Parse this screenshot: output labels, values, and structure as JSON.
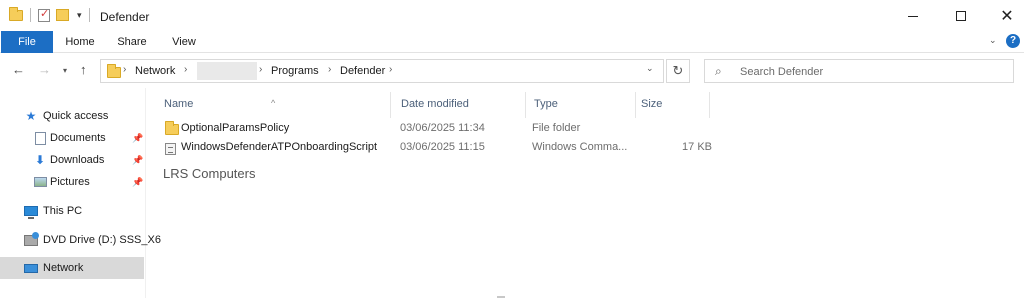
{
  "window": {
    "title": "Defender",
    "controls": {
      "minimize": "—",
      "maximize": "☐",
      "close": "✕"
    }
  },
  "ribbon": {
    "tabs": [
      "File",
      "Home",
      "Share",
      "View"
    ],
    "accent": "#1c6ec4",
    "help": "?"
  },
  "address": {
    "crumbs": [
      "Network",
      "",
      "Programs",
      "Defender"
    ],
    "separator": "›"
  },
  "search": {
    "placeholder": "Search Defender"
  },
  "sidebar": {
    "items": [
      {
        "label": "Quick access",
        "icon": "star-icon",
        "pinned": false
      },
      {
        "label": "Documents",
        "icon": "documents-icon",
        "pinned": true
      },
      {
        "label": "Downloads",
        "icon": "download-icon",
        "pinned": true
      },
      {
        "label": "Pictures",
        "icon": "pictures-icon",
        "pinned": true
      },
      {
        "label": "This PC",
        "icon": "computer-icon",
        "pinned": false
      },
      {
        "label": "DVD Drive (D:) SSS_X6",
        "icon": "dvd-drive-icon",
        "pinned": false
      },
      {
        "label": "Network",
        "icon": "network-icon",
        "pinned": false,
        "selected": true
      }
    ]
  },
  "columns": {
    "name": "Name",
    "date": "Date modified",
    "type": "Type",
    "size": "Size"
  },
  "files": [
    {
      "name": "OptionalParamsPolicy",
      "date": "03/06/2025 11:34",
      "type": "File folder",
      "size": "",
      "icon": "folder-icon"
    },
    {
      "name": "WindowsDefenderATPOnboardingScript",
      "date": "03/06/2025 11:15",
      "type": "Windows Comma...",
      "size": "17 KB",
      "icon": "script-icon"
    }
  ],
  "watermark": "LRS Computers"
}
